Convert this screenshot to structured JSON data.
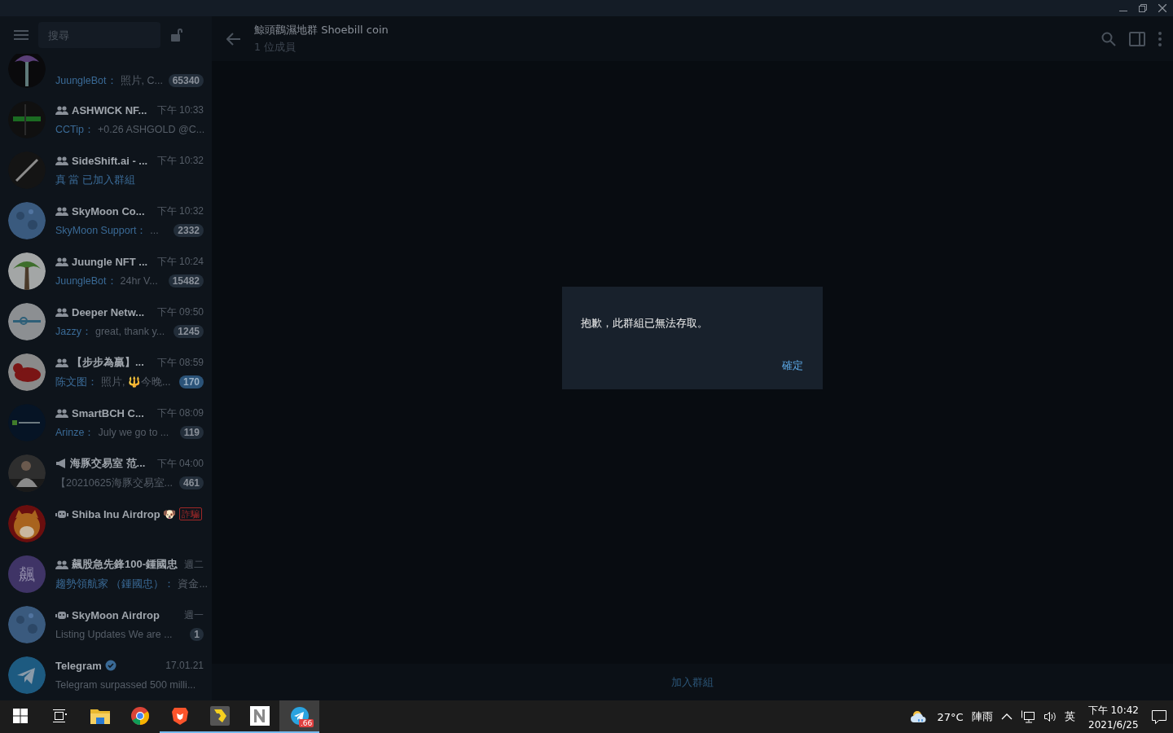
{
  "sidebar": {
    "search": {
      "placeholder": "搜尋"
    },
    "chats": [
      {
        "kind": "partial",
        "avatar": {
          "kind": "palm-dark"
        },
        "sender": "JuungleBot：",
        "preview": "照片, C...",
        "badge": "65340",
        "badge_muted": true
      },
      {
        "kind": "group",
        "avatar": {
          "kind": "ashwick"
        },
        "title": "ASHWICK NF...",
        "time": "下午 10:33",
        "sender": "CCTip：",
        "preview": "+0.26 ASHGOLD  @C..."
      },
      {
        "kind": "group",
        "avatar": {
          "kind": "slash"
        },
        "title": "SideShift.ai - ...",
        "time": "下午 10:32",
        "sender": "真 當 已加入群組"
      },
      {
        "kind": "group",
        "avatar": {
          "kind": "moon"
        },
        "title": "SkyMoon Co...",
        "time": "下午 10:32",
        "sender": "SkyMoon Support：",
        "preview": "...",
        "badge": "2332",
        "badge_muted": true
      },
      {
        "kind": "group",
        "avatar": {
          "kind": "palm"
        },
        "title": "Juungle NFT ...",
        "time": "下午 10:24",
        "sender": "JuungleBot：",
        "preview": "24hr V...",
        "badge": "15482",
        "badge_muted": true
      },
      {
        "kind": "group",
        "avatar": {
          "kind": "deeper"
        },
        "title": "Deeper Netw...",
        "time": "下午 09:50",
        "sender": "Jazzy：",
        "preview": "great, thank y...",
        "badge": "1245",
        "badge_muted": true
      },
      {
        "kind": "group",
        "avatar": {
          "kind": "bull"
        },
        "title": "【步步為贏】...",
        "time": "下午 08:59",
        "sender": "陈文图：",
        "preview": "照片, 🔱今晚...",
        "badge": "170",
        "badge_muted": false
      },
      {
        "kind": "group",
        "avatar": {
          "kind": "smartbch"
        },
        "title": "SmartBCH C...",
        "time": "下午 08:09",
        "sender": "Arinze：",
        "preview": "July we go to ...",
        "badge": "119",
        "badge_muted": true
      },
      {
        "kind": "channel",
        "avatar": {
          "kind": "photo"
        },
        "title": "海豚交易室 范...",
        "time": "下午 04:00",
        "preview": "【20210625海豚交易室...",
        "badge": "461",
        "badge_muted": true
      },
      {
        "kind": "bot",
        "avatar": {
          "kind": "shiba"
        },
        "title": "Shiba Inu Airdrop 🐶",
        "scam": "詐騙"
      },
      {
        "kind": "group",
        "avatar": {
          "kind": "letter",
          "letter": "飆"
        },
        "title": "飆股急先鋒100-鍾國忠",
        "time": "週二",
        "sender": "趨勢領航家 （鍾國忠）：",
        "preview": "資金..."
      },
      {
        "kind": "bot",
        "avatar": {
          "kind": "moon"
        },
        "title": "SkyMoon Airdrop",
        "time": "週一",
        "preview": "Listing Updates  We are ...",
        "badge": "1",
        "badge_muted": true
      },
      {
        "kind": "user",
        "avatar": {
          "kind": "telegram"
        },
        "title": "Telegram",
        "verified": true,
        "time": "17.01.21",
        "preview": "Telegram surpassed 500 milli..."
      }
    ]
  },
  "chat": {
    "title": "鯨頭鸛濕地群 Shoebill coin",
    "subtitle": "1 位成員",
    "join": "加入群組"
  },
  "dialog": {
    "message": "抱歉，此群組已無法存取。",
    "button": "確定"
  },
  "taskbar": {
    "apps": [
      {
        "kind": "explorer",
        "running": false,
        "active": false
      },
      {
        "kind": "chrome",
        "running": false,
        "active": false
      },
      {
        "kind": "brave",
        "running": true,
        "active": false
      },
      {
        "kind": "yellow",
        "running": true,
        "active": false
      },
      {
        "kind": "n",
        "running": true,
        "active": false
      },
      {
        "kind": "telegram",
        "running": true,
        "active": true,
        "badge": ".66"
      }
    ],
    "weather": {
      "temp": "27°C",
      "text": "陣雨"
    },
    "ime": "英",
    "time": "下午 10:42",
    "date": "2021/6/25"
  }
}
